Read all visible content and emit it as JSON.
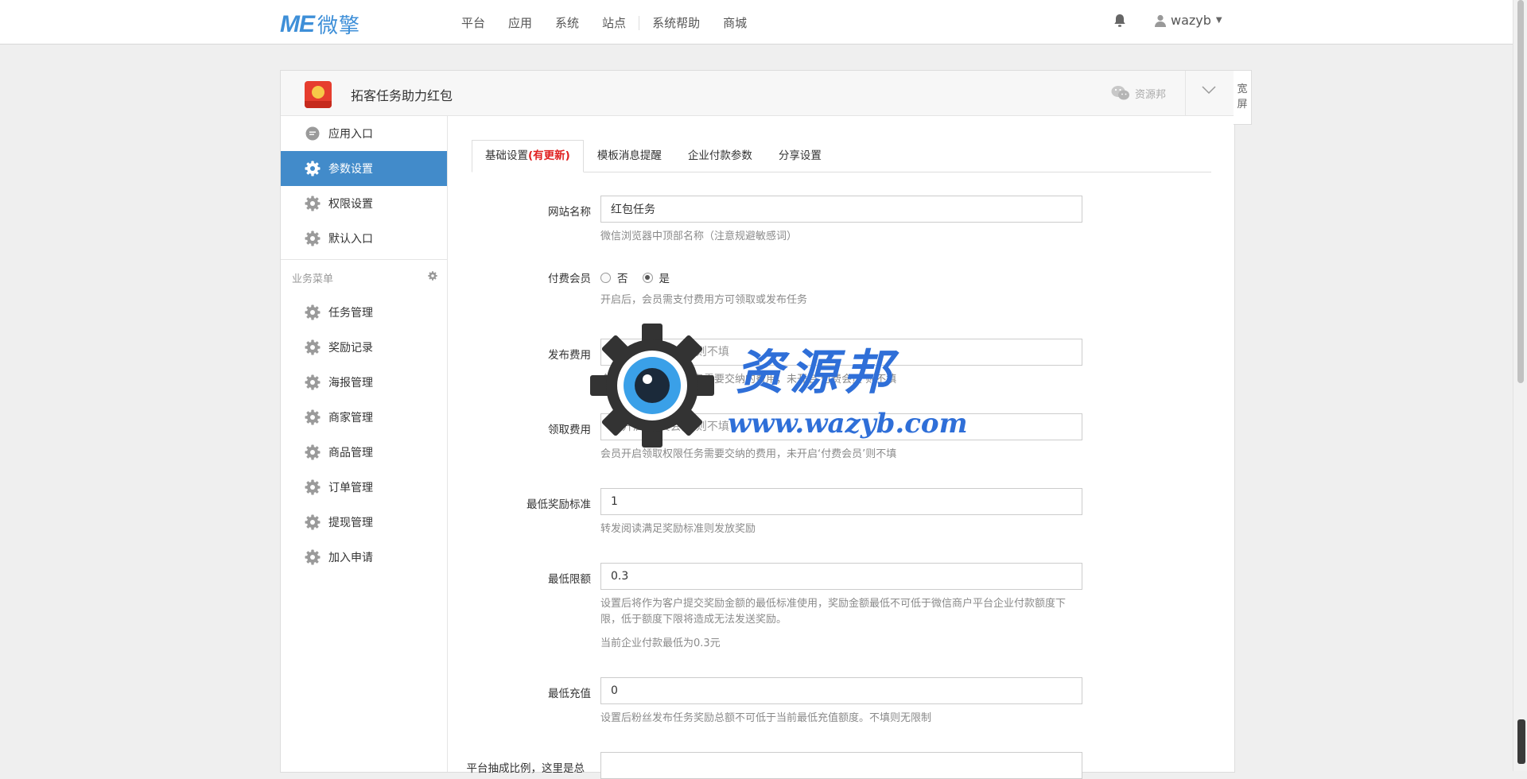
{
  "topbar": {
    "brand_latin": "ME",
    "brand_cn": "微擎",
    "nav": [
      "平台",
      "应用",
      "系统",
      "站点",
      "系统帮助",
      "商城"
    ],
    "user": "wazyb"
  },
  "panel": {
    "app_title": "拓客任务助力红包",
    "wechat_account": "资源邦",
    "wide_screen": "宽屏"
  },
  "sidebar": {
    "top_items": [
      {
        "label": "应用入口",
        "icon": "chat-icon"
      },
      {
        "label": "参数设置",
        "icon": "gear-icon",
        "active": true
      },
      {
        "label": "权限设置",
        "icon": "gear-icon"
      },
      {
        "label": "默认入口",
        "icon": "gear-icon"
      }
    ],
    "group_title": "业务菜单",
    "business_items": [
      "任务管理",
      "奖励记录",
      "海报管理",
      "商家管理",
      "商品管理",
      "订单管理",
      "提现管理",
      "加入申请"
    ]
  },
  "tabs": {
    "basic": "基础设置",
    "basic_badge": "(有更新)",
    "template": "模板消息提醒",
    "payment": "企业付款参数",
    "share": "分享设置"
  },
  "form": {
    "site_name": {
      "label": "网站名称",
      "value": "红包任务",
      "help": "微信浏览器中顶部名称（注意规避敏感词）"
    },
    "paid_member": {
      "label": "付费会员",
      "option_no": "否",
      "option_yes": "是",
      "selected": "是",
      "help": "开启后，会员需支付费用方可领取或发布任务"
    },
    "publish_fee": {
      "label": "发布费用",
      "placeholder": "未开启‘付费会员’则不填",
      "help": "会员开启发布权限任务需要交纳的费用，未开启‘付费会员’则不填"
    },
    "receive_fee": {
      "label": "领取费用",
      "placeholder": "未开启‘付费会员’则不填",
      "help": "会员开启领取权限任务需要交纳的费用，未开启‘付费会员’则不填"
    },
    "min_reward": {
      "label": "最低奖励标准",
      "value": "1",
      "help": "转发阅读满足奖励标准则发放奖励"
    },
    "min_limit": {
      "label": "最低限额",
      "value": "0.3",
      "help": "设置后将作为客户提交奖励金额的最低标准使用，奖励金额最低不可低于微信商户平台企业付款额度下限，低于额度下限将造成无法发送奖励。",
      "help2": "当前企业付款最低为0.3元"
    },
    "min_recharge": {
      "label": "最低充值",
      "value": "0",
      "help": "设置后粉丝发布任务奖励总额不可低于当前最低充值额度。不填则无限制"
    },
    "platform_ratio": {
      "label": "平台抽成比例，这里是总"
    }
  },
  "watermark": {
    "cn": "资源邦",
    "en": "www.wazyb.com"
  },
  "colors": {
    "accent": "#428bca",
    "brand": "#3e8fd8",
    "badge": "#e02020",
    "watermark": "#2f6fd8"
  }
}
